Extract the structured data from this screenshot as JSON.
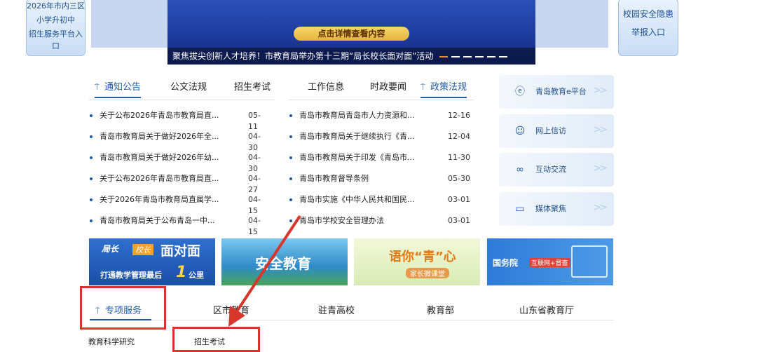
{
  "banner": {
    "left_box": [
      "2026年市内三区",
      "小学升初中",
      "招生服务平台入",
      "口"
    ],
    "right_box": [
      "校园安全隐患",
      "举报入口"
    ],
    "button": "点击详情查看内容",
    "caption": "聚焦拔尖创新人才培养！市教育局举办第十三期“局长校长面对面”活动"
  },
  "tabs": {
    "left": [
      "通知公告",
      "公文法规",
      "招生考试"
    ],
    "right": [
      "工作信息",
      "时政要闻",
      "政策法规"
    ]
  },
  "left_news": [
    {
      "title": "关于公布2026年青岛市教育局直...",
      "date": "05-11"
    },
    {
      "title": "青岛市教育局关于做好2026年全...",
      "date": "04-30"
    },
    {
      "title": "青岛市教育局关于做好2026年幼...",
      "date": "04-30"
    },
    {
      "title": "关于公布2026年青岛市教育局直...",
      "date": "04-27"
    },
    {
      "title": "关于2026年青岛市教育局直属学...",
      "date": "04-15"
    },
    {
      "title": "青岛市教育局关于公布青岛一中...",
      "date": "04-15"
    }
  ],
  "right_news": [
    {
      "title": "青岛市教育局青岛市人力资源和...",
      "date": "12-16"
    },
    {
      "title": "青岛市教育局关于继续执行《青...",
      "date": "12-04"
    },
    {
      "title": "青岛市教育局关于印发《青岛市...",
      "date": "11-30"
    },
    {
      "title": "青岛市教育督导条例",
      "date": "05-30"
    },
    {
      "title": "青岛市实施《中华人民共和国民...",
      "date": "03-01"
    },
    {
      "title": "青岛市学校安全管理办法",
      "date": "03-01"
    }
  ],
  "services": [
    {
      "label": "青岛教育e平台",
      "icon": "e-platform-icon"
    },
    {
      "label": "网上信访",
      "icon": "user-icon"
    },
    {
      "label": "互动交流",
      "icon": "link-icon"
    },
    {
      "label": "媒体聚焦",
      "icon": "video-icon"
    }
  ],
  "tiles": {
    "t1_a": "局长",
    "t1_b": "校长",
    "t1_c": "面对面",
    "t1_d": "打通教学管理最后",
    "t1_e": "1",
    "t1_f": "公里",
    "t2": "安全教育",
    "t3_a": "语你“青”心",
    "t3_b": "家长微课堂",
    "t4_a": "国务院",
    "t4_b": "互联网+督查"
  },
  "bottom_tabs": [
    "专项服务",
    "区市教育",
    "驻青高校",
    "教育部",
    "山东省教育厅"
  ],
  "sub_items": [
    "教育科学研究",
    "招生考试"
  ],
  "colors": {
    "accent": "#1f5ba8",
    "highlight": "#d8352b"
  }
}
